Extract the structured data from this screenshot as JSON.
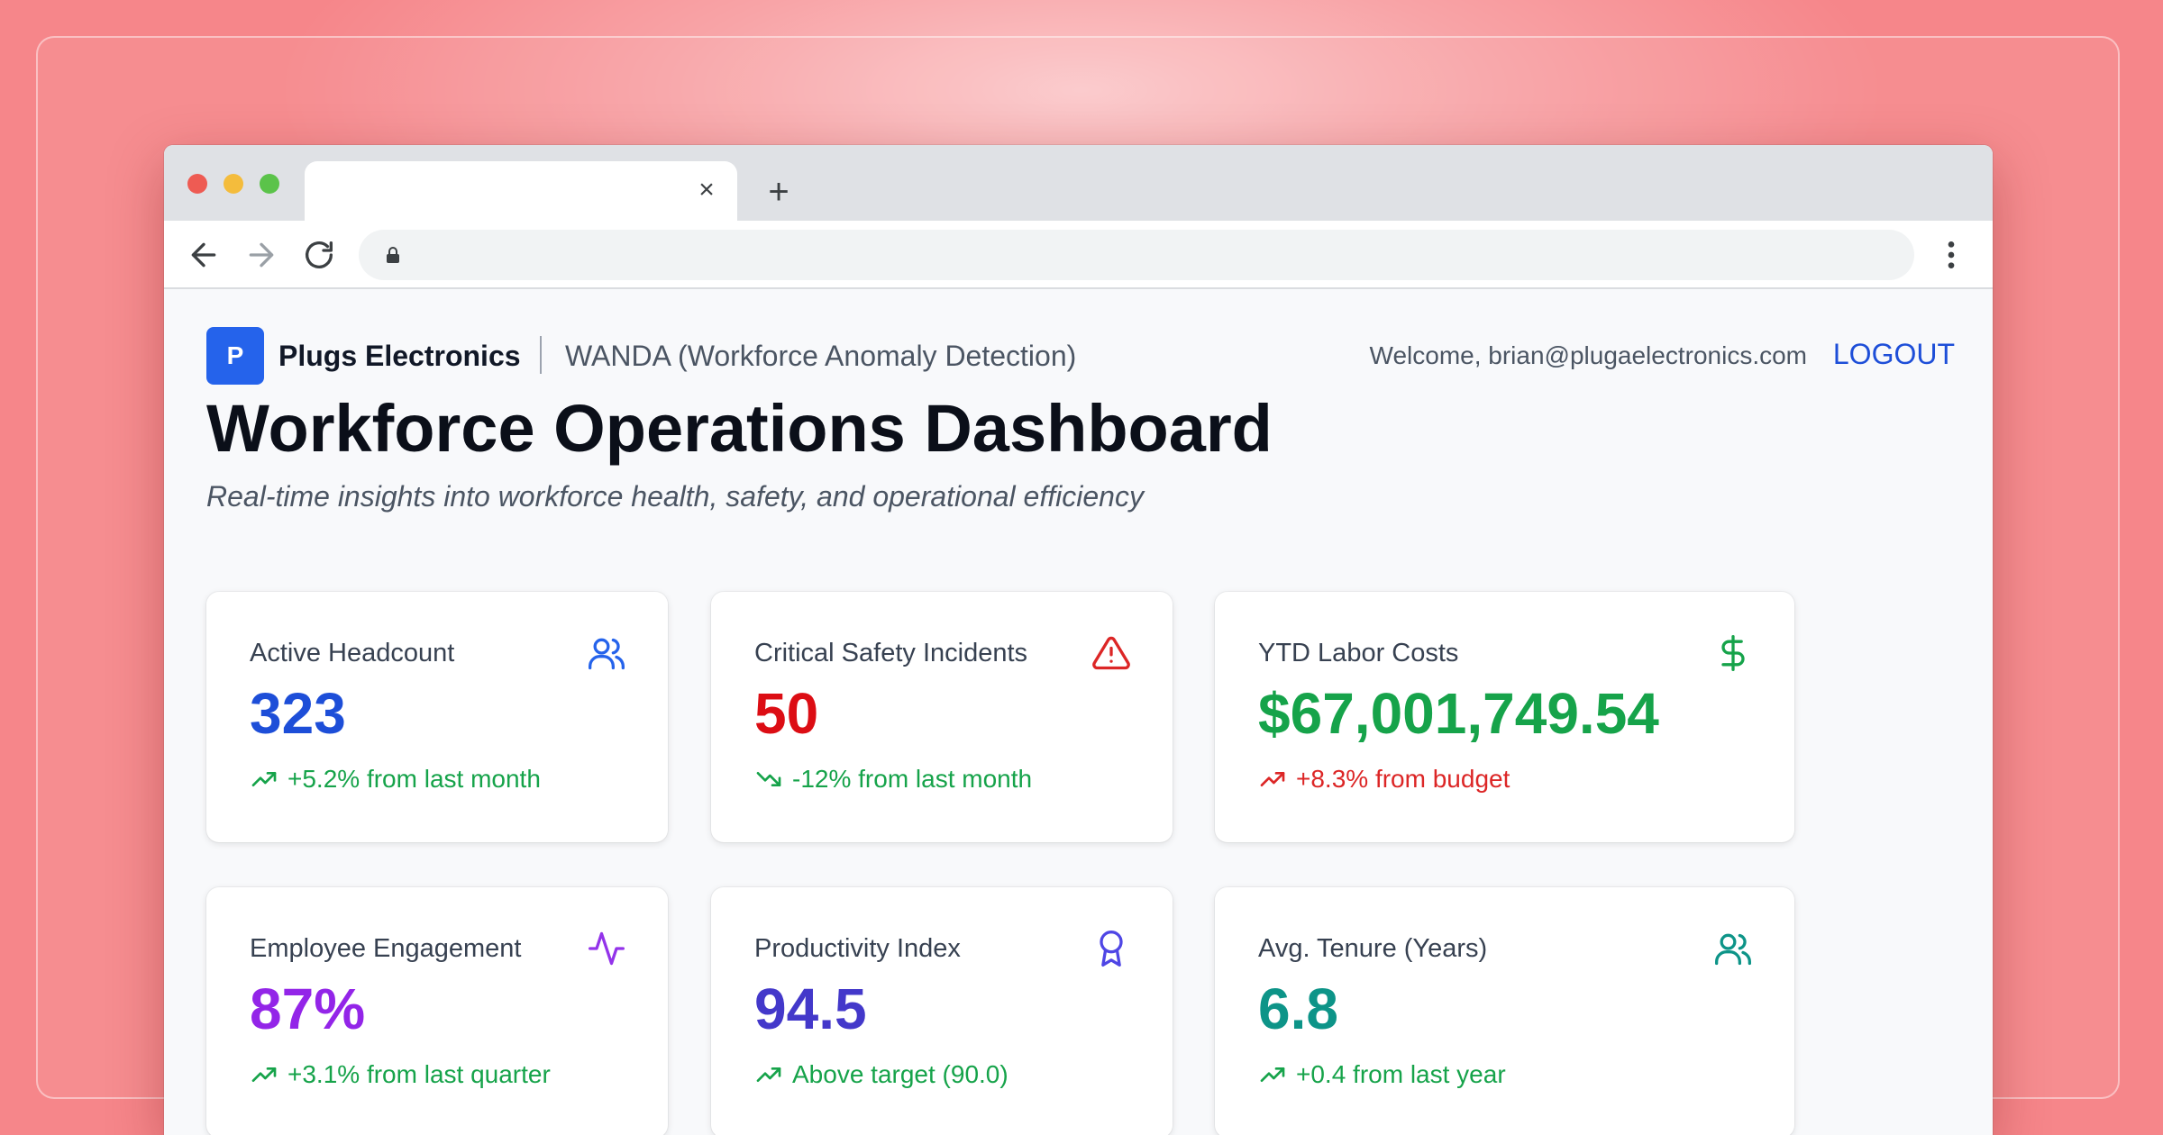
{
  "browser": {
    "tab_close": "×",
    "new_tab": "+"
  },
  "header": {
    "logo_letter": "P",
    "brand": "Plugs Electronics",
    "app": "WANDA (Workforce Anomaly Detection)",
    "welcome": "Welcome, brian@plugaelectronics.com",
    "logout": "LOGOUT"
  },
  "title": "Workforce Operations Dashboard",
  "subtitle": "Real-time insights into workforce health, safety, and operational efficiency",
  "colors": {
    "blue": "#1d4ed8",
    "red": "#dc0d14",
    "green": "#16a34a",
    "purple": "#9325e8",
    "indigo": "#4338ca",
    "teal": "#0d9488",
    "up_green": "#16a34a",
    "up_red": "#dc2626"
  },
  "cards": [
    {
      "label": "Active Headcount",
      "value": "323",
      "change": "+5.2% from last month",
      "icon": "users-icon"
    },
    {
      "label": "Critical Safety Incidents",
      "value": "50",
      "change": "-12% from last month",
      "icon": "alert-triangle-icon"
    },
    {
      "label": "YTD Labor Costs",
      "value": "$67,001,749.54",
      "change": "+8.3% from budget",
      "icon": "dollar-icon"
    },
    {
      "label": "Employee Engagement",
      "value": "87%",
      "change": "+3.1% from last quarter",
      "icon": "activity-icon"
    },
    {
      "label": "Productivity Index",
      "value": "94.5",
      "change": "Above target (90.0)",
      "icon": "award-icon"
    },
    {
      "label": "Avg. Tenure (Years)",
      "value": "6.8",
      "change": "+0.4 from last year",
      "icon": "users-icon"
    }
  ]
}
